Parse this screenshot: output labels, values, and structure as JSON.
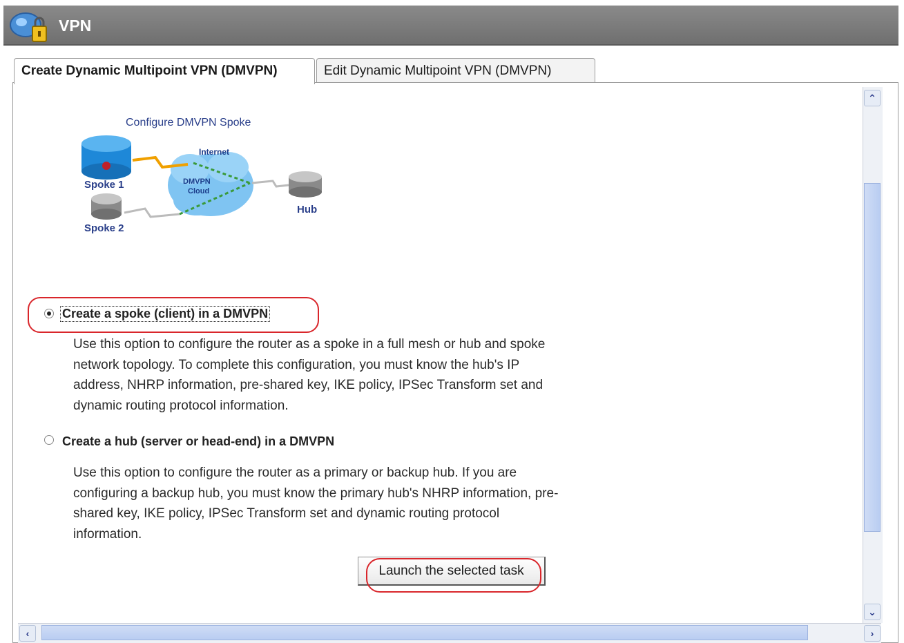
{
  "header": {
    "title": "VPN",
    "icon": "vpn-lock-icon"
  },
  "tabs": [
    {
      "label": "Create Dynamic Multipoint VPN (DMVPN)",
      "active": true
    },
    {
      "label": "Edit Dynamic Multipoint VPN (DMVPN)",
      "active": false
    }
  ],
  "diagram": {
    "title": "Configure DMVPN Spoke",
    "labels": {
      "spoke1": "Spoke 1",
      "spoke2": "Spoke 2",
      "hub": "Hub",
      "internet": "Internet",
      "cloud": "DMVPN Cloud"
    }
  },
  "options": [
    {
      "label": "Create a spoke (client) in a DMVPN",
      "selected": true,
      "description": "Use this option to configure the router as a spoke in a full mesh or hub and spoke network topology. To complete this configuration, you must know the hub's IP address, NHRP information, pre-shared key, IKE policy, IPSec Transform set and dynamic routing protocol information."
    },
    {
      "label": "Create a hub (server or head-end) in a DMVPN",
      "selected": false,
      "description": "Use this option to configure the router as a primary or backup hub. If you are configuring a backup hub, you must know the primary hub's NHRP information, pre-shared key, IKE policy, IPSec Transform set and dynamic routing protocol information."
    }
  ],
  "launch_button": {
    "label": "Launch the selected task"
  },
  "colors": {
    "header_bg": "#7a7a7a",
    "highlight": "#d9262b",
    "scroll_thumb": "#c4d4f3"
  }
}
